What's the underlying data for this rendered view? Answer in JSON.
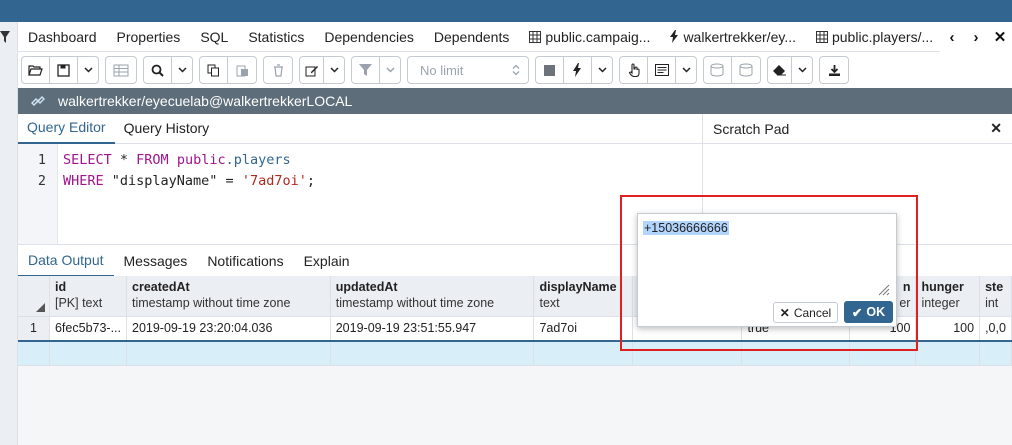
{
  "tabs": [
    {
      "label": "Dashboard",
      "icon": ""
    },
    {
      "label": "Properties",
      "icon": ""
    },
    {
      "label": "SQL",
      "icon": ""
    },
    {
      "label": "Statistics",
      "icon": ""
    },
    {
      "label": "Dependencies",
      "icon": ""
    },
    {
      "label": "Dependents",
      "icon": ""
    },
    {
      "label": "public.campaig...",
      "icon": "table-icon"
    },
    {
      "label": "walkertrekker/ey...",
      "icon": "bolt-icon"
    },
    {
      "label": "public.players/...",
      "icon": "table-icon"
    }
  ],
  "toolbar": {
    "limit_label": "No limit"
  },
  "connection": {
    "label": "walkertrekker/eyecuelab@walkertrekkerLOCAL"
  },
  "query_tabs": {
    "editor": "Query Editor",
    "history": "Query History"
  },
  "scratch": {
    "title": "Scratch Pad"
  },
  "editor": {
    "line1": {
      "n": "1",
      "a": "SELECT",
      "b": " * ",
      "c": "FROM",
      "d": " ",
      "e": "public",
      "f": ".players"
    },
    "line2": {
      "n": "2",
      "a": "WHERE",
      "b": " \"displayName\" = ",
      "c": "'7ad7oi'",
      "d": ";"
    }
  },
  "output_tabs": [
    "Data Output",
    "Messages",
    "Notifications",
    "Explain"
  ],
  "grid": {
    "columns": [
      {
        "name": "id",
        "type": "[PK] text"
      },
      {
        "name": "createdAt",
        "type": "timestamp without time zone"
      },
      {
        "name": "updatedAt",
        "type": "timestamp without time zone"
      },
      {
        "name": "displayName",
        "type": "text"
      },
      {
        "name": "",
        "type": ""
      },
      {
        "name": "",
        "type": ""
      },
      {
        "name": "n",
        "type": "er"
      },
      {
        "name": "hunger",
        "type": "integer"
      },
      {
        "name": "ste",
        "type": "int"
      }
    ],
    "row": {
      "n": "1",
      "id": "6fec5b73-...",
      "createdAt": "2019-09-19 23:20:04.036",
      "updatedAt": "2019-09-19 23:51:55.947",
      "displayName": "7ad7oi",
      "c5": "",
      "c6": "true",
      "c7": "100",
      "hunger": "100",
      "ste": ",0,0"
    }
  },
  "popup": {
    "value": "+15036666666",
    "cancel_label": "Cancel",
    "ok_label": "OK"
  },
  "colors": {
    "accent": "#326690",
    "connection_bar": "#5d6d79",
    "highlight": "#e02020"
  }
}
